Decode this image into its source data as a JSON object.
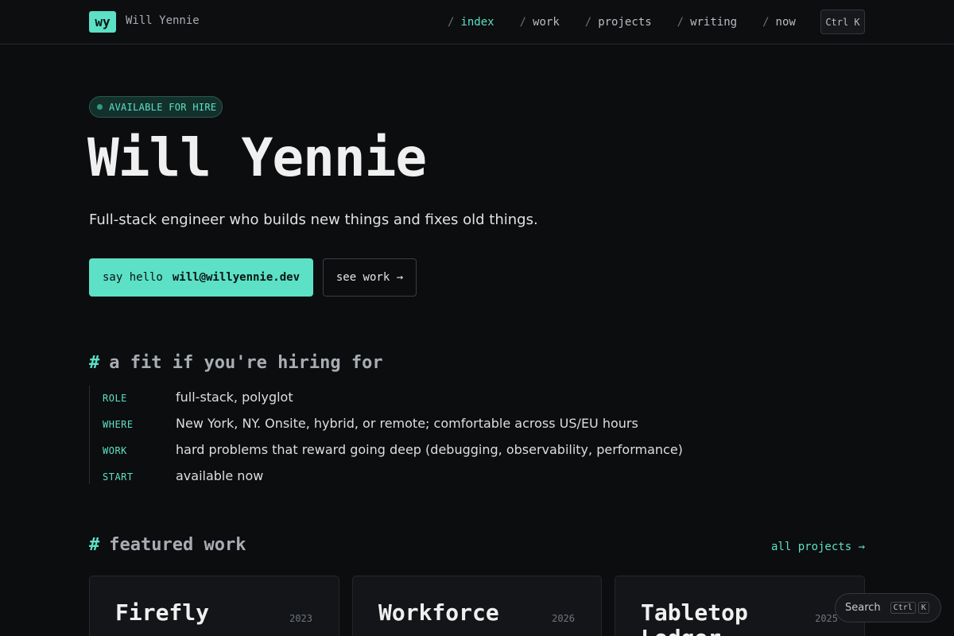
{
  "header": {
    "logo_text": "wy",
    "site_name": "Will Yennie",
    "nav": [
      {
        "label": "index",
        "active": true
      },
      {
        "label": "work",
        "active": false
      },
      {
        "label": "projects",
        "active": false
      },
      {
        "label": "writing",
        "active": false
      },
      {
        "label": "now",
        "active": false
      }
    ],
    "nav_separator": "/",
    "command_shortcut": "Ctrl K"
  },
  "hero": {
    "badge": "AVAILABLE FOR HIRE",
    "title": "Will Yennie",
    "tagline": "Full-stack engineer who builds new things and fixes old things.",
    "cta_primary_label": "say hello",
    "cta_primary_email": "will@willyennie.dev",
    "cta_secondary": "see work →"
  },
  "fit": {
    "hash": "#",
    "heading": "a fit if you're hiring for",
    "rows": [
      {
        "key": "ROLE",
        "value": "full-stack, polyglot"
      },
      {
        "key": "WHERE",
        "value": "New York, NY. Onsite, hybrid, or remote; comfortable across US/EU hours"
      },
      {
        "key": "WORK",
        "value": "hard problems that reward going deep (debugging, observability, performance)"
      },
      {
        "key": "START",
        "value": "available now"
      }
    ]
  },
  "featured": {
    "hash": "#",
    "heading": "featured work",
    "all_link": "all projects →",
    "cards": [
      {
        "title": "Firefly",
        "year": "2023"
      },
      {
        "title": "Workforce",
        "year": "2026"
      },
      {
        "title": "Tabletop Ledger",
        "year": "2025"
      }
    ]
  },
  "search": {
    "label": "Search",
    "key1": "Ctrl",
    "key2": "K"
  },
  "colors": {
    "accent": "#5ce0c6",
    "background": "#0c0d0f"
  }
}
